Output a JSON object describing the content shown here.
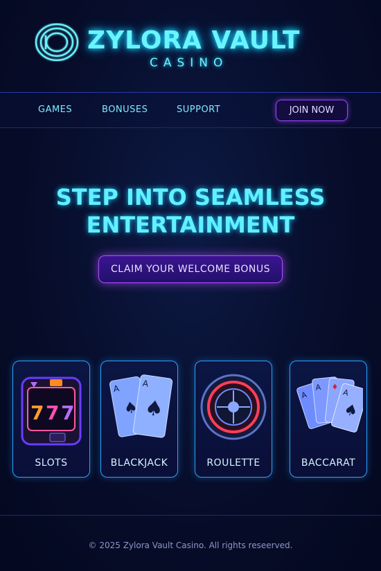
{
  "header": {
    "brand": "ZYLORA VAULT",
    "subtitle": "CASINO",
    "logo_icon": "vault-ring-icon"
  },
  "nav": {
    "items": [
      {
        "label": "GAMES"
      },
      {
        "label": "BONUSES"
      },
      {
        "label": "SUPPORT"
      }
    ],
    "join_label": "JOIN NOW"
  },
  "hero": {
    "title_line1": "STEP INTO SEAMLESS",
    "title_line2": "ENTERTAINMENT",
    "cta_label": "CLAIM YOUR WELCOME BONUS"
  },
  "games": [
    {
      "label": "SLOTS",
      "icon": "slot-machine-icon"
    },
    {
      "label": "BLACKJACK",
      "icon": "playing-cards-icon"
    },
    {
      "label": "ROULETTE",
      "icon": "roulette-wheel-icon"
    },
    {
      "label": "BACCARAT",
      "icon": "card-fan-icon"
    }
  ],
  "footer": {
    "copyright": "© 2025 Zylora Vault Casino. All rights reseerved."
  },
  "colors": {
    "accent_cyan": "#6af4ff",
    "accent_purple": "#a044ff",
    "card_border": "#2aa3ff",
    "background": "#070d2a"
  }
}
